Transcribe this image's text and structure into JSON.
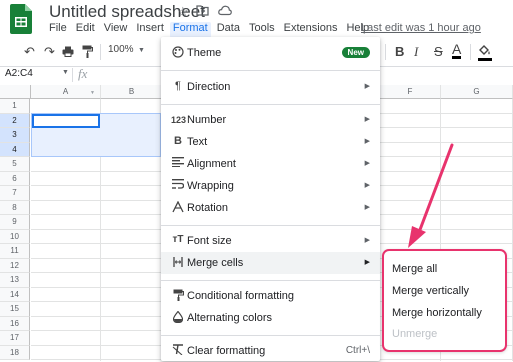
{
  "app": {
    "title": "Untitled spreadsheet",
    "last_edit": "Last edit was 1 hour ago",
    "brand_color": "#188038"
  },
  "menubar": {
    "items": [
      "File",
      "Edit",
      "View",
      "Insert",
      "Format",
      "Data",
      "Tools",
      "Extensions",
      "Help"
    ],
    "active": "Format"
  },
  "toolbar": {
    "zoom": "100%",
    "icons": [
      "undo-icon",
      "redo-icon",
      "print-icon",
      "paint-format-icon"
    ],
    "bold": "B",
    "italic": "I",
    "strike": "S",
    "text_color": "A"
  },
  "formula_bar": {
    "name_box": "A2:C4",
    "fx": "fx"
  },
  "grid": {
    "columns": [
      "A",
      "B",
      "",
      "",
      "",
      "F",
      "G"
    ],
    "rows": [
      "1",
      "2",
      "3",
      "4",
      "5",
      "6",
      "7",
      "8",
      "9",
      "10",
      "11",
      "12",
      "13",
      "14",
      "15",
      "16",
      "17",
      "18"
    ],
    "selected_range": "A2:C4"
  },
  "format_menu": {
    "theme": {
      "label": "Theme",
      "badge": "New",
      "icon": "palette-icon"
    },
    "direction": {
      "label": "Direction",
      "icon": "paragraph-icon"
    },
    "number": {
      "label": "Number",
      "icon": "number-icon"
    },
    "text": {
      "label": "Text",
      "icon": "bold-icon"
    },
    "alignment": {
      "label": "Alignment",
      "icon": "align-icon"
    },
    "wrapping": {
      "label": "Wrapping",
      "icon": "wrap-icon"
    },
    "rotation": {
      "label": "Rotation",
      "icon": "rotation-icon"
    },
    "font_size": {
      "label": "Font size",
      "icon": "font-size-icon"
    },
    "merge_cells": {
      "label": "Merge cells",
      "icon": "merge-icon"
    },
    "conditional": {
      "label": "Conditional formatting",
      "icon": "conditional-icon"
    },
    "alternating": {
      "label": "Alternating colors",
      "icon": "fill-drop-icon"
    },
    "clear": {
      "label": "Clear formatting",
      "shortcut": "Ctrl+\\",
      "icon": "clear-format-icon"
    }
  },
  "merge_submenu": {
    "merge_all": "Merge all",
    "merge_vertically": "Merge vertically",
    "merge_horizontally": "Merge horizontally",
    "unmerge": "Unmerge",
    "highlight_color": "#e8336d"
  }
}
